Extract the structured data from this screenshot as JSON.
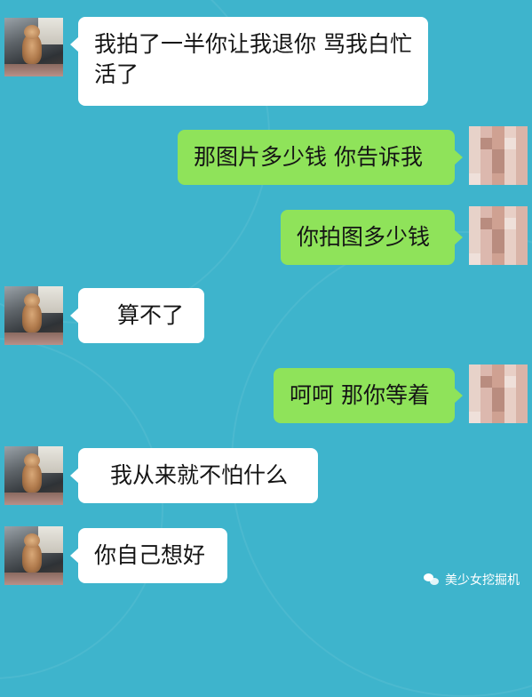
{
  "messages": [
    {
      "side": "left",
      "text": "我拍了一半你让我退你 骂我白忙活了"
    },
    {
      "side": "right",
      "text": "那图片多少钱 你告诉我"
    },
    {
      "side": "right",
      "text": "你拍图多少钱"
    },
    {
      "side": "left",
      "text": "算不了"
    },
    {
      "side": "right",
      "text": "呵呵 那你等着"
    },
    {
      "side": "left",
      "text": "我从来就不怕什么"
    },
    {
      "side": "left",
      "text": "你自己想好"
    }
  ],
  "watermark": {
    "icon": "wechat-icon",
    "text": "美少女挖掘机"
  },
  "colors": {
    "background": "#3eb4cc",
    "sent_bubble": "#8fe35a",
    "received_bubble": "#ffffff"
  }
}
